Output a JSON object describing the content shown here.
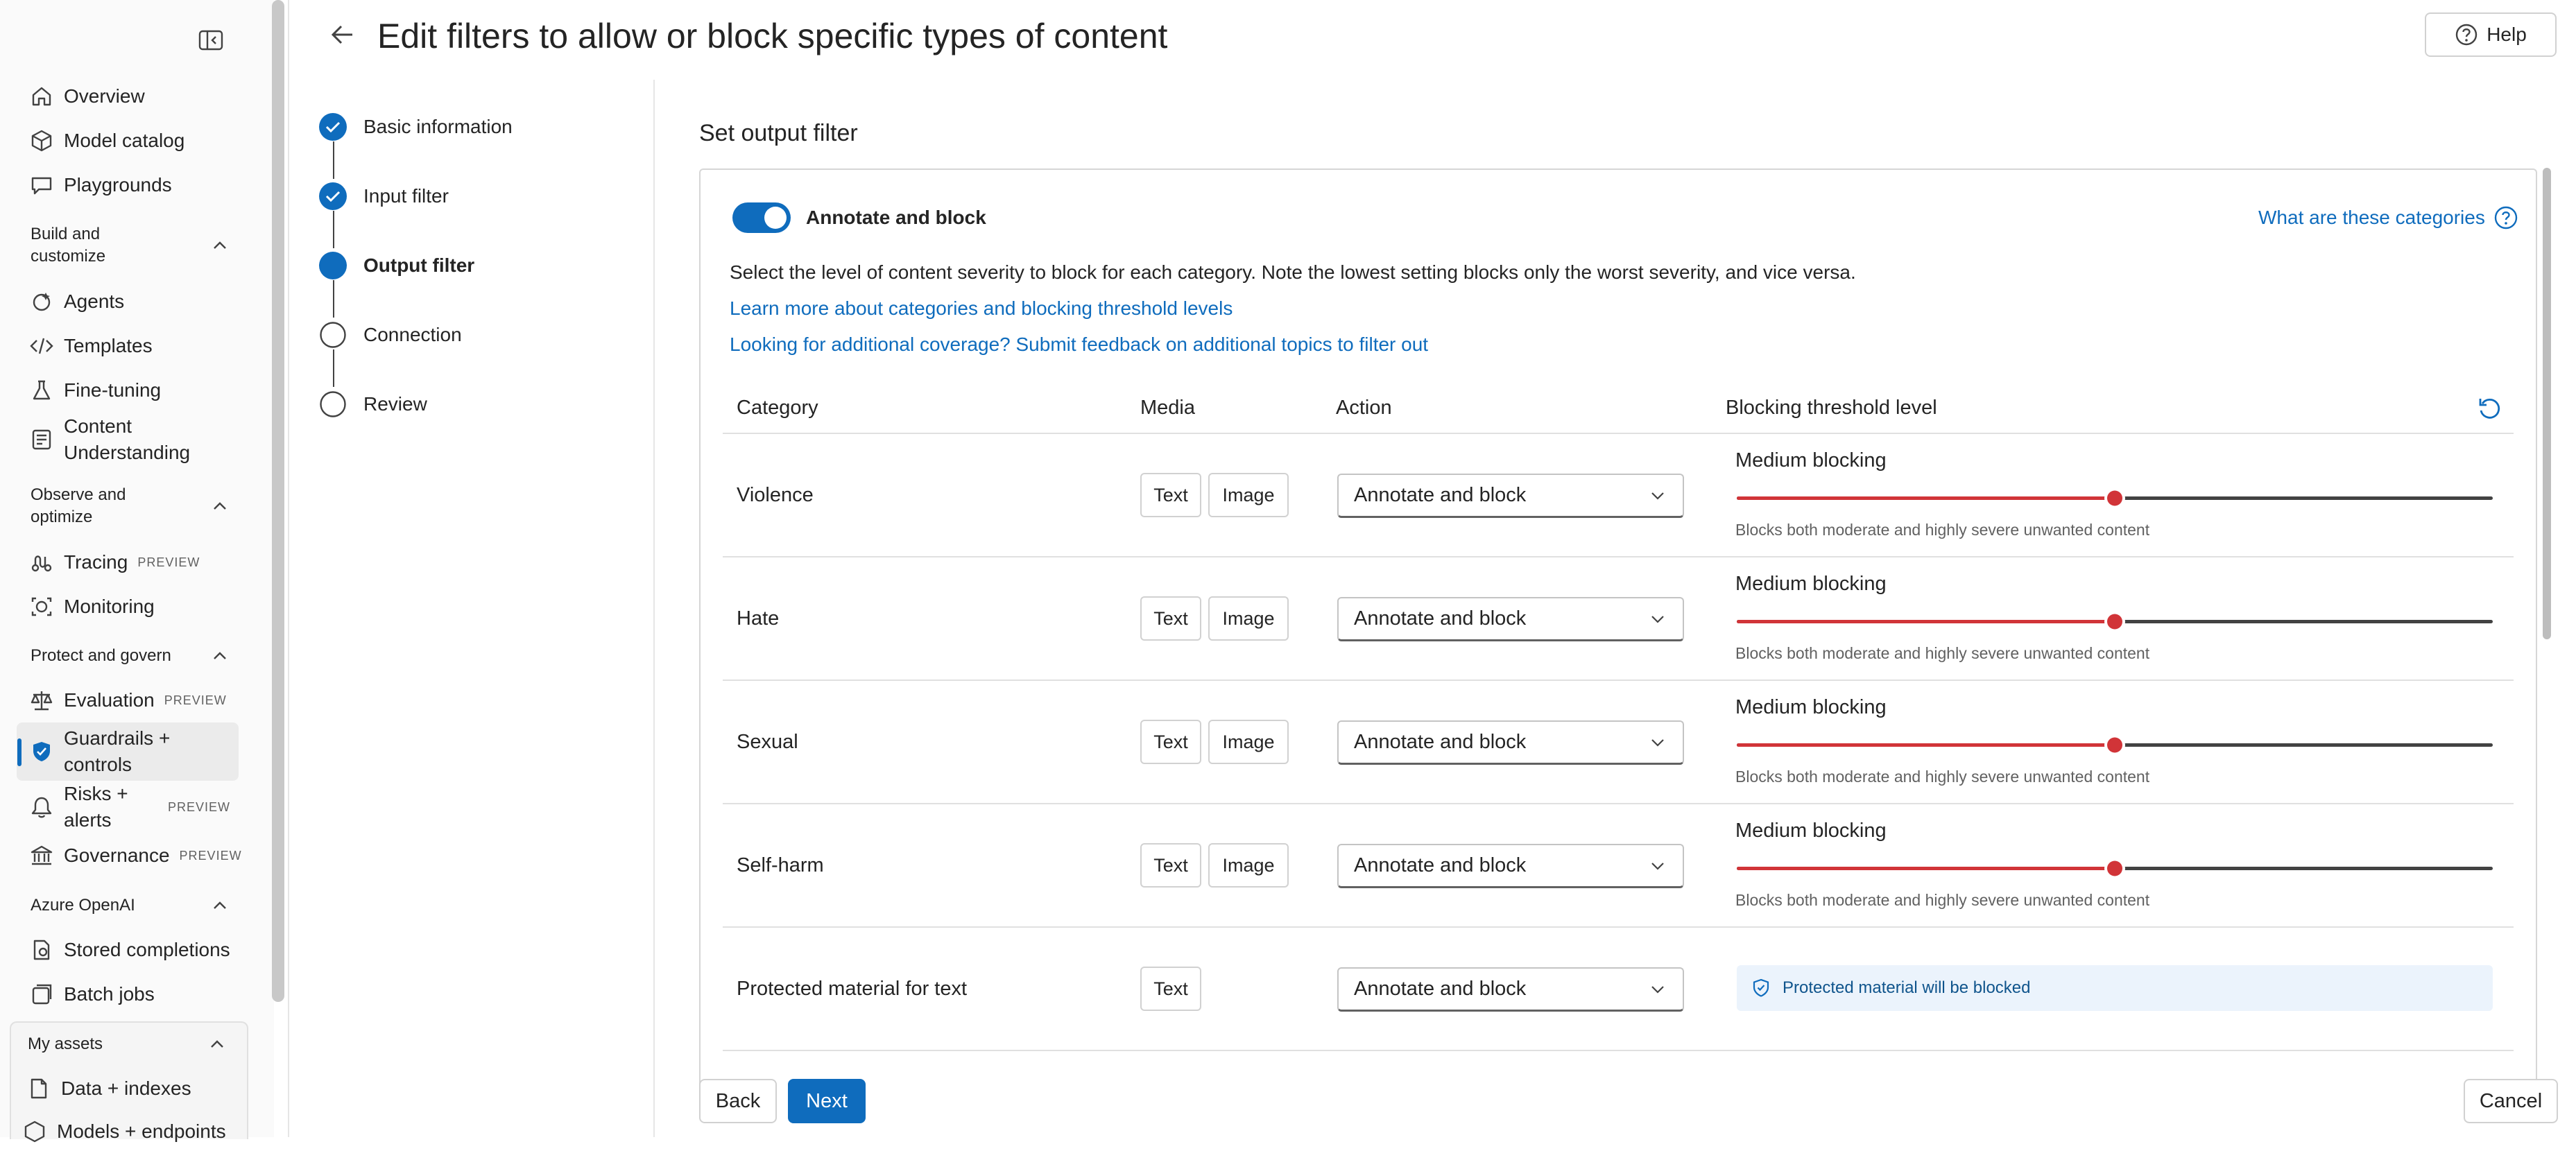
{
  "sidebar": {
    "items": [
      {
        "label": "Overview",
        "icon": "home-icon"
      },
      {
        "label": "Model catalog",
        "icon": "cube-icon"
      },
      {
        "label": "Playgrounds",
        "icon": "chat-icon"
      },
      {
        "label": "Agents",
        "icon": "agents-icon"
      },
      {
        "label": "Templates",
        "icon": "code-icon"
      },
      {
        "label": "Fine-tuning",
        "icon": "flask-icon"
      },
      {
        "label": "Content Understanding",
        "icon": "document-icon"
      },
      {
        "label": "Tracing",
        "icon": "tracing-icon",
        "badge": "PREVIEW"
      },
      {
        "label": "Monitoring",
        "icon": "monitoring-icon"
      },
      {
        "label": "Evaluation",
        "icon": "scale-icon",
        "badge": "PREVIEW"
      },
      {
        "label": "Guardrails + controls",
        "icon": "shield-icon"
      },
      {
        "label": "Risks + alerts",
        "icon": "alert-icon",
        "badge": "PREVIEW"
      },
      {
        "label": "Governance",
        "icon": "building-icon",
        "badge": "PREVIEW"
      },
      {
        "label": "Stored completions",
        "icon": "stored-icon"
      },
      {
        "label": "Batch jobs",
        "icon": "batch-icon"
      },
      {
        "label": "Data + indexes",
        "icon": "data-icon"
      },
      {
        "label": "Models + endpoints",
        "icon": "models-icon"
      }
    ],
    "sections": [
      {
        "label": "Build and customize"
      },
      {
        "label": "Observe and optimize"
      },
      {
        "label": "Protect and govern"
      },
      {
        "label": "Azure OpenAI"
      },
      {
        "label": "My assets"
      }
    ]
  },
  "header": {
    "title": "Edit filters to allow or block specific types of content",
    "help_label": "Help"
  },
  "stepper": {
    "steps": [
      {
        "label": "Basic information",
        "state": "completed"
      },
      {
        "label": "Input filter",
        "state": "completed"
      },
      {
        "label": "Output filter",
        "state": "current"
      },
      {
        "label": "Connection",
        "state": "pending"
      },
      {
        "label": "Review",
        "state": "pending"
      }
    ]
  },
  "main": {
    "section_title": "Set output filter",
    "toggle_label": "Annotate and block",
    "toggle_on": true,
    "categories_link": "What are these categories",
    "description": "Select the level of content severity to block for each category. Note the lowest setting blocks only the worst severity, and vice versa.",
    "link_learn_more": "Learn more about categories and blocking threshold levels",
    "link_feedback": "Looking for additional coverage? Submit feedback on additional topics to filter out",
    "table": {
      "headers": [
        "Category",
        "Media",
        "Action",
        "Blocking threshold level"
      ],
      "rows": [
        {
          "category": "Violence",
          "media": [
            "Text",
            "Image"
          ],
          "action": "Annotate and block",
          "threshold_title": "Medium blocking",
          "threshold_value": 0.5,
          "threshold_note": "Blocks both moderate and highly severe unwanted content"
        },
        {
          "category": "Hate",
          "media": [
            "Text",
            "Image"
          ],
          "action": "Annotate and block",
          "threshold_title": "Medium blocking",
          "threshold_value": 0.5,
          "threshold_note": "Blocks both moderate and highly severe unwanted content"
        },
        {
          "category": "Sexual",
          "media": [
            "Text",
            "Image"
          ],
          "action": "Annotate and block",
          "threshold_title": "Medium blocking",
          "threshold_value": 0.5,
          "threshold_note": "Blocks both moderate and highly severe unwanted content"
        },
        {
          "category": "Self-harm",
          "media": [
            "Text",
            "Image"
          ],
          "action": "Annotate and block",
          "threshold_title": "Medium blocking",
          "threshold_value": 0.5,
          "threshold_note": "Blocks both moderate and highly severe unwanted content"
        },
        {
          "category": "Protected material for text",
          "media": [
            "Text"
          ],
          "action": "Annotate and block",
          "info": "Protected material will be blocked"
        }
      ]
    }
  },
  "footer": {
    "back_label": "Back",
    "next_label": "Next",
    "cancel_label": "Cancel"
  },
  "colors": {
    "accent": "#0f6cbd",
    "slider_active": "#d13438",
    "slider_track": "#424242",
    "info_bg": "#ebf3fc"
  }
}
